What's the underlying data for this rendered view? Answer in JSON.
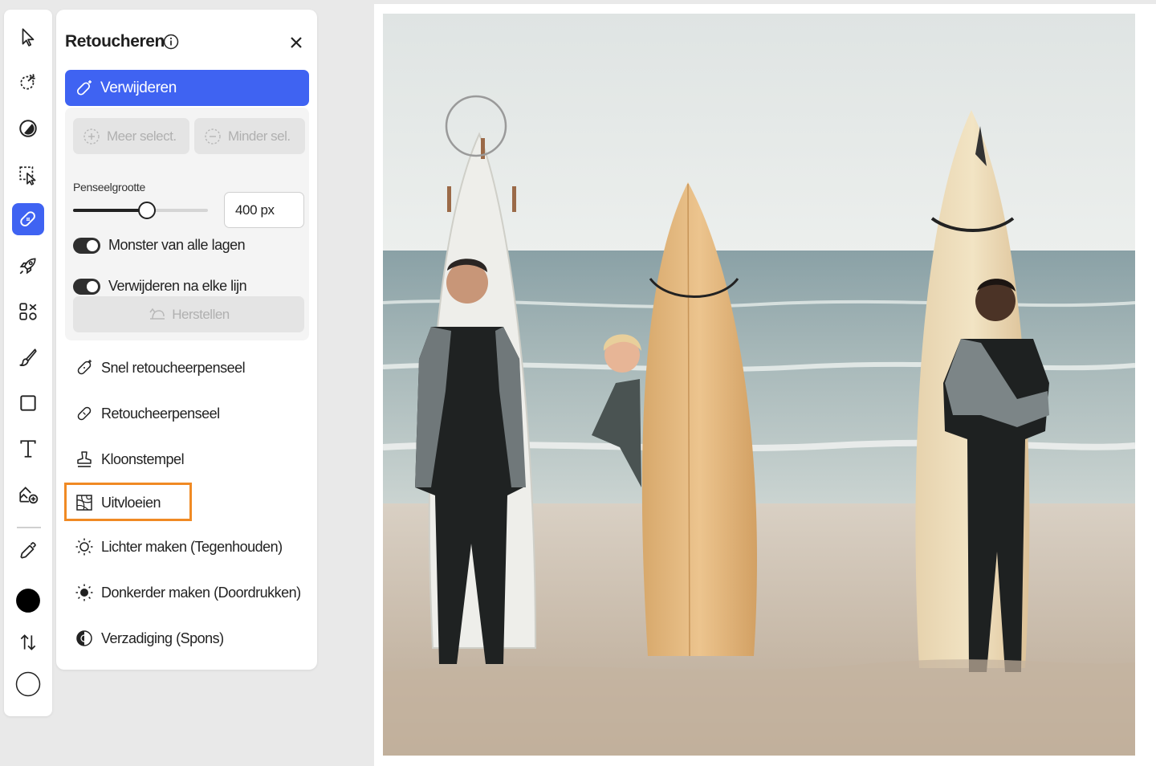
{
  "toolbar": {
    "tools": [
      {
        "name": "select-tool",
        "icon": "arrow-pointer-icon"
      },
      {
        "name": "quick-select-tool",
        "icon": "magic-select-icon"
      },
      {
        "name": "adjust-tool",
        "icon": "adjust-circle-icon"
      },
      {
        "name": "transform-tool",
        "icon": "transform-select-icon"
      },
      {
        "name": "retouch-tool",
        "icon": "bandage-icon",
        "active": true
      },
      {
        "name": "quick-actions-tool",
        "icon": "rocket-icon"
      },
      {
        "name": "add-elements-tool",
        "icon": "elements-grid-icon"
      },
      {
        "name": "brush-tool",
        "icon": "brush-icon"
      },
      {
        "name": "shape-tool",
        "icon": "rectangle-icon"
      },
      {
        "name": "text-tool",
        "icon": "text-icon"
      },
      {
        "name": "generative-fill-tool",
        "icon": "image-add-icon"
      },
      {
        "name": "eyedropper-tool",
        "icon": "eyedropper-icon"
      }
    ],
    "foreground_color": "#000000",
    "background_color": "#ffffff"
  },
  "panel": {
    "title": "Retoucheren",
    "primary_button": "Verwijderen",
    "more_select": "Meer select.",
    "less_select": "Minder sel.",
    "brush_size_label": "Penseelgrootte",
    "brush_size_value": "400 px",
    "brush_size_fraction": 0.55,
    "toggles": [
      {
        "label": "Monster van alle lagen",
        "on": true
      },
      {
        "label": "Verwijderen na elke lijn",
        "on": true
      }
    ],
    "restore_button": "Herstellen",
    "tools": [
      {
        "label": "Snel retoucheerpenseel"
      },
      {
        "label": "Retoucheerpenseel"
      },
      {
        "label": "Kloonstempel"
      },
      {
        "label": "Uitvloeien",
        "highlighted": true
      },
      {
        "label": "Lichter maken (Tegenhouden)"
      },
      {
        "label": "Donkerder maken (Doordrukken)"
      },
      {
        "label": "Verzadiging (Spons)"
      }
    ]
  },
  "colors": {
    "accent": "#3f63f2",
    "highlight": "#f08a24"
  }
}
